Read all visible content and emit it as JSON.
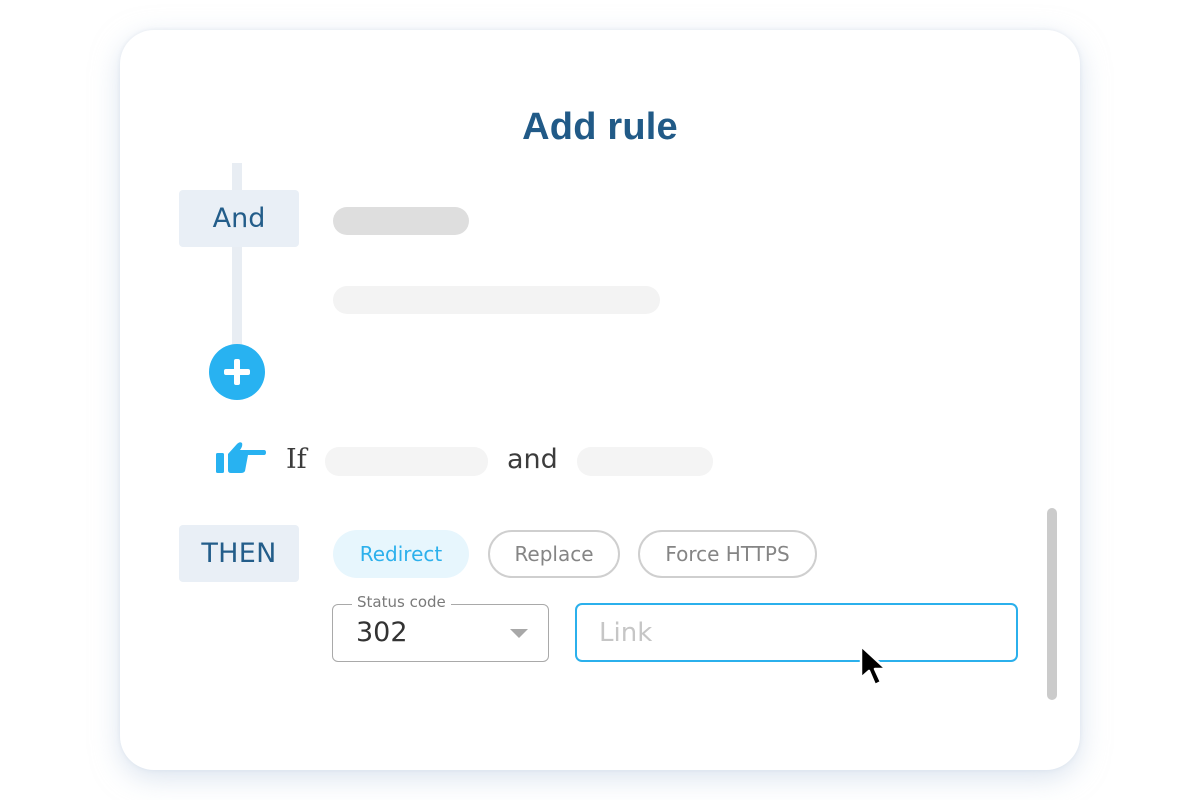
{
  "dialog": {
    "title": "Add rule"
  },
  "condition_block": {
    "operator_tag": "And",
    "add_button_icon": "plus-icon"
  },
  "if_row": {
    "icon": "pointing-hand-icon",
    "if_label": "If",
    "and_label": "and"
  },
  "then_block": {
    "tag": "THEN",
    "actions": [
      {
        "label": "Redirect",
        "selected": true
      },
      {
        "label": "Replace",
        "selected": false
      },
      {
        "label": "Force HTTPS",
        "selected": false
      }
    ],
    "status_code": {
      "label": "Status code",
      "value": "302"
    },
    "link": {
      "placeholder": "Link",
      "value": ""
    }
  },
  "colors": {
    "title": "#215a87",
    "accent": "#28b2f1",
    "tag_background": "#e9eff6",
    "selected_chip_background": "#e7f6fd"
  }
}
